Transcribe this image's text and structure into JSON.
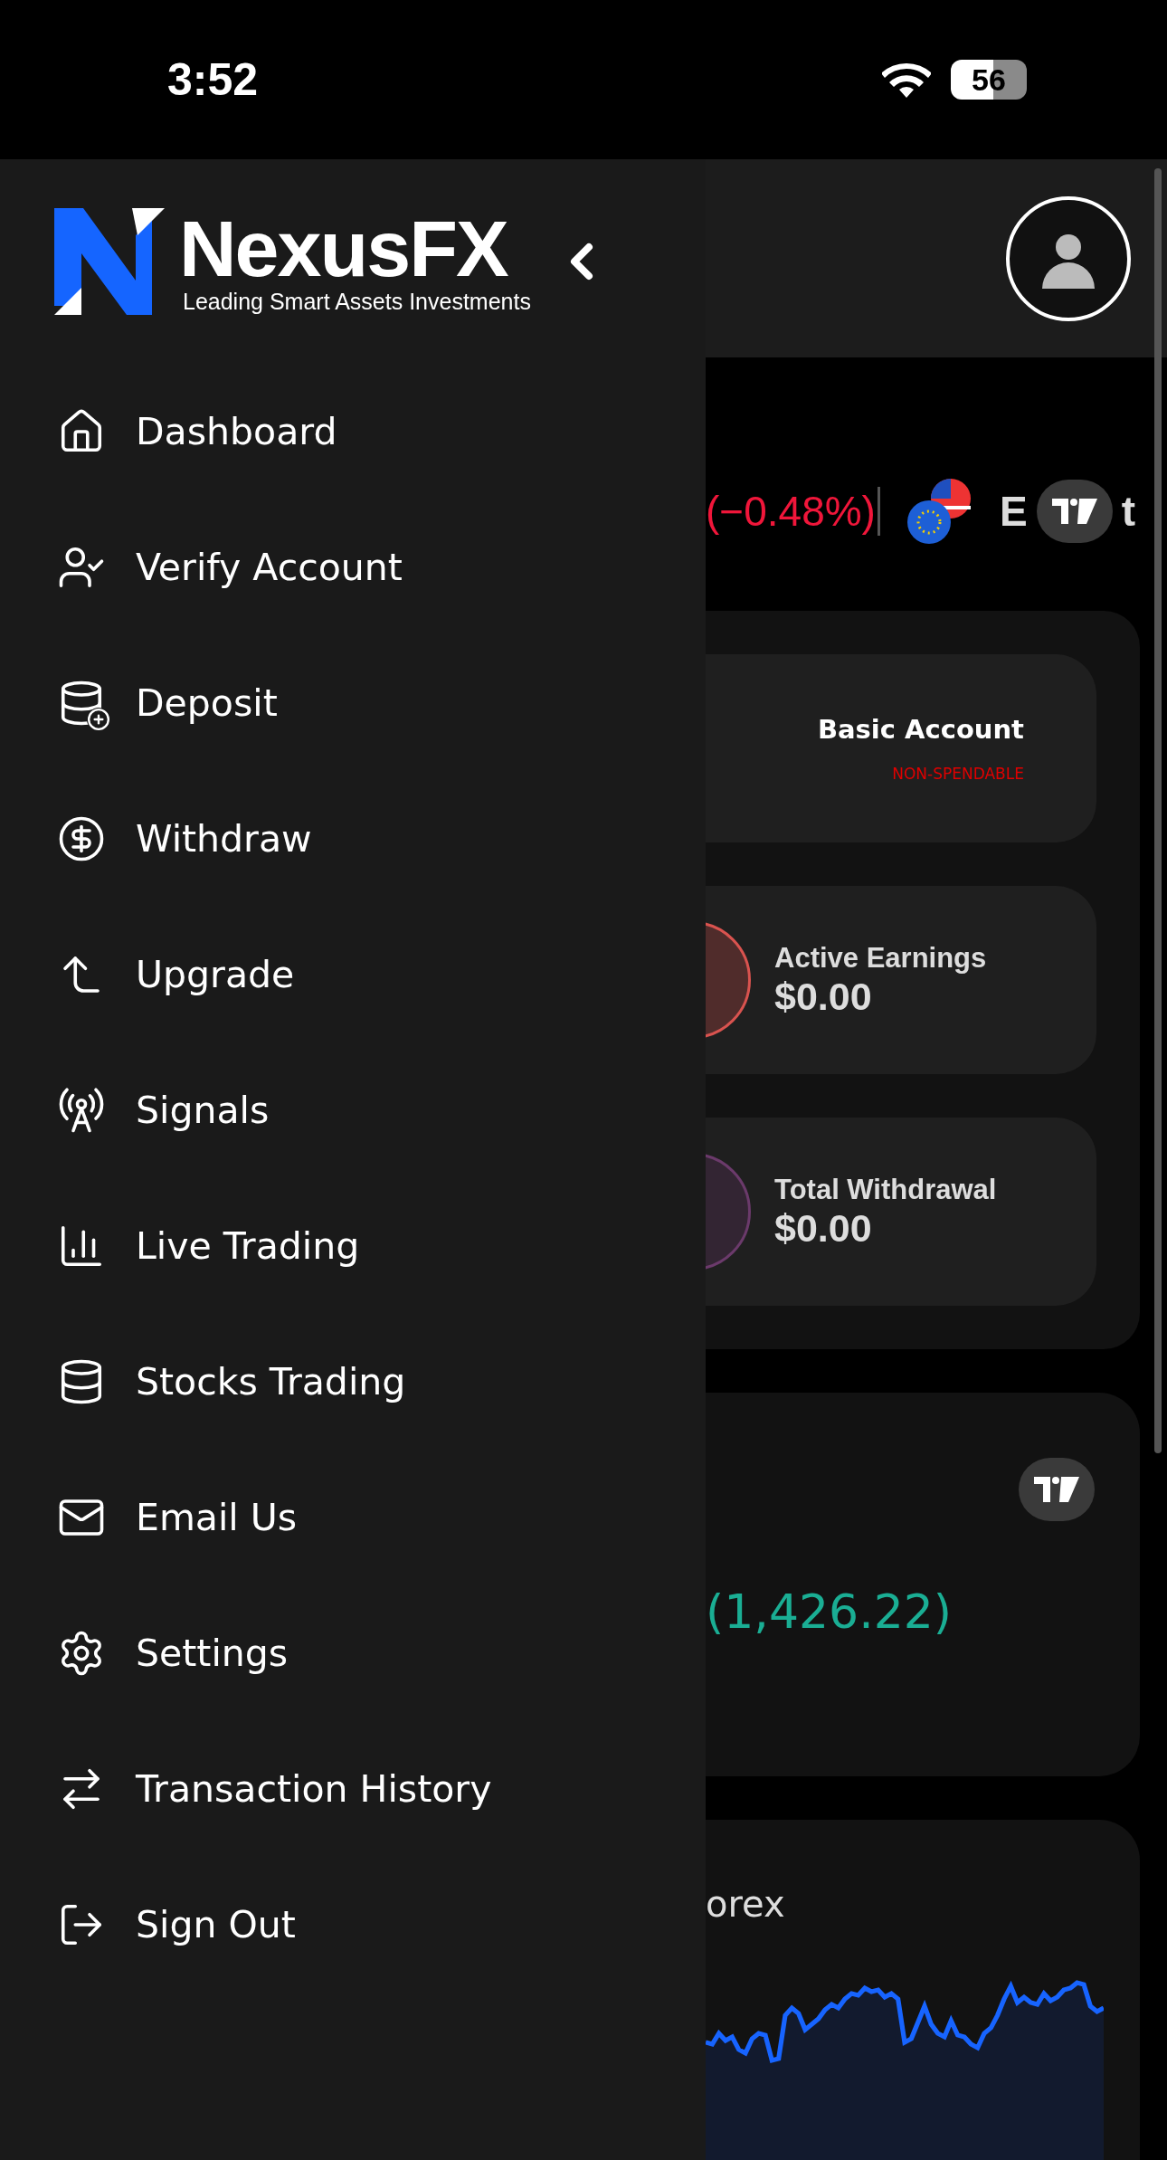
{
  "status_bar": {
    "time": "3:52",
    "battery": "56"
  },
  "drawer": {
    "brand": "NexusFX",
    "tagline": "Leading Smart Assets Investments",
    "items": [
      {
        "label": "Dashboard"
      },
      {
        "label": "Verify Account"
      },
      {
        "label": "Deposit"
      },
      {
        "label": "Withdraw"
      },
      {
        "label": "Upgrade"
      },
      {
        "label": "Signals"
      },
      {
        "label": "Live Trading"
      },
      {
        "label": "Stocks Trading"
      },
      {
        "label": "Email Us"
      },
      {
        "label": "Settings"
      },
      {
        "label": "Transaction History"
      },
      {
        "label": "Sign Out"
      }
    ]
  },
  "ticker": {
    "change": "(−0.48%)",
    "name_parts": [
      "E",
      "t"
    ]
  },
  "balance_cards": [
    {
      "kind": "account",
      "title": "Basic Account",
      "note": "NON-SPENDABLE"
    },
    {
      "kind": "stat",
      "title": "Active Earnings",
      "value": "$0.00",
      "color": "#d9534f"
    },
    {
      "kind": "stat",
      "title": "Total Withdrawal",
      "value": "$0.00",
      "color": "#6b3a6b"
    }
  ],
  "market_card": {
    "change": "(1,426.22)"
  },
  "forex_card": {
    "title": "orex"
  }
}
